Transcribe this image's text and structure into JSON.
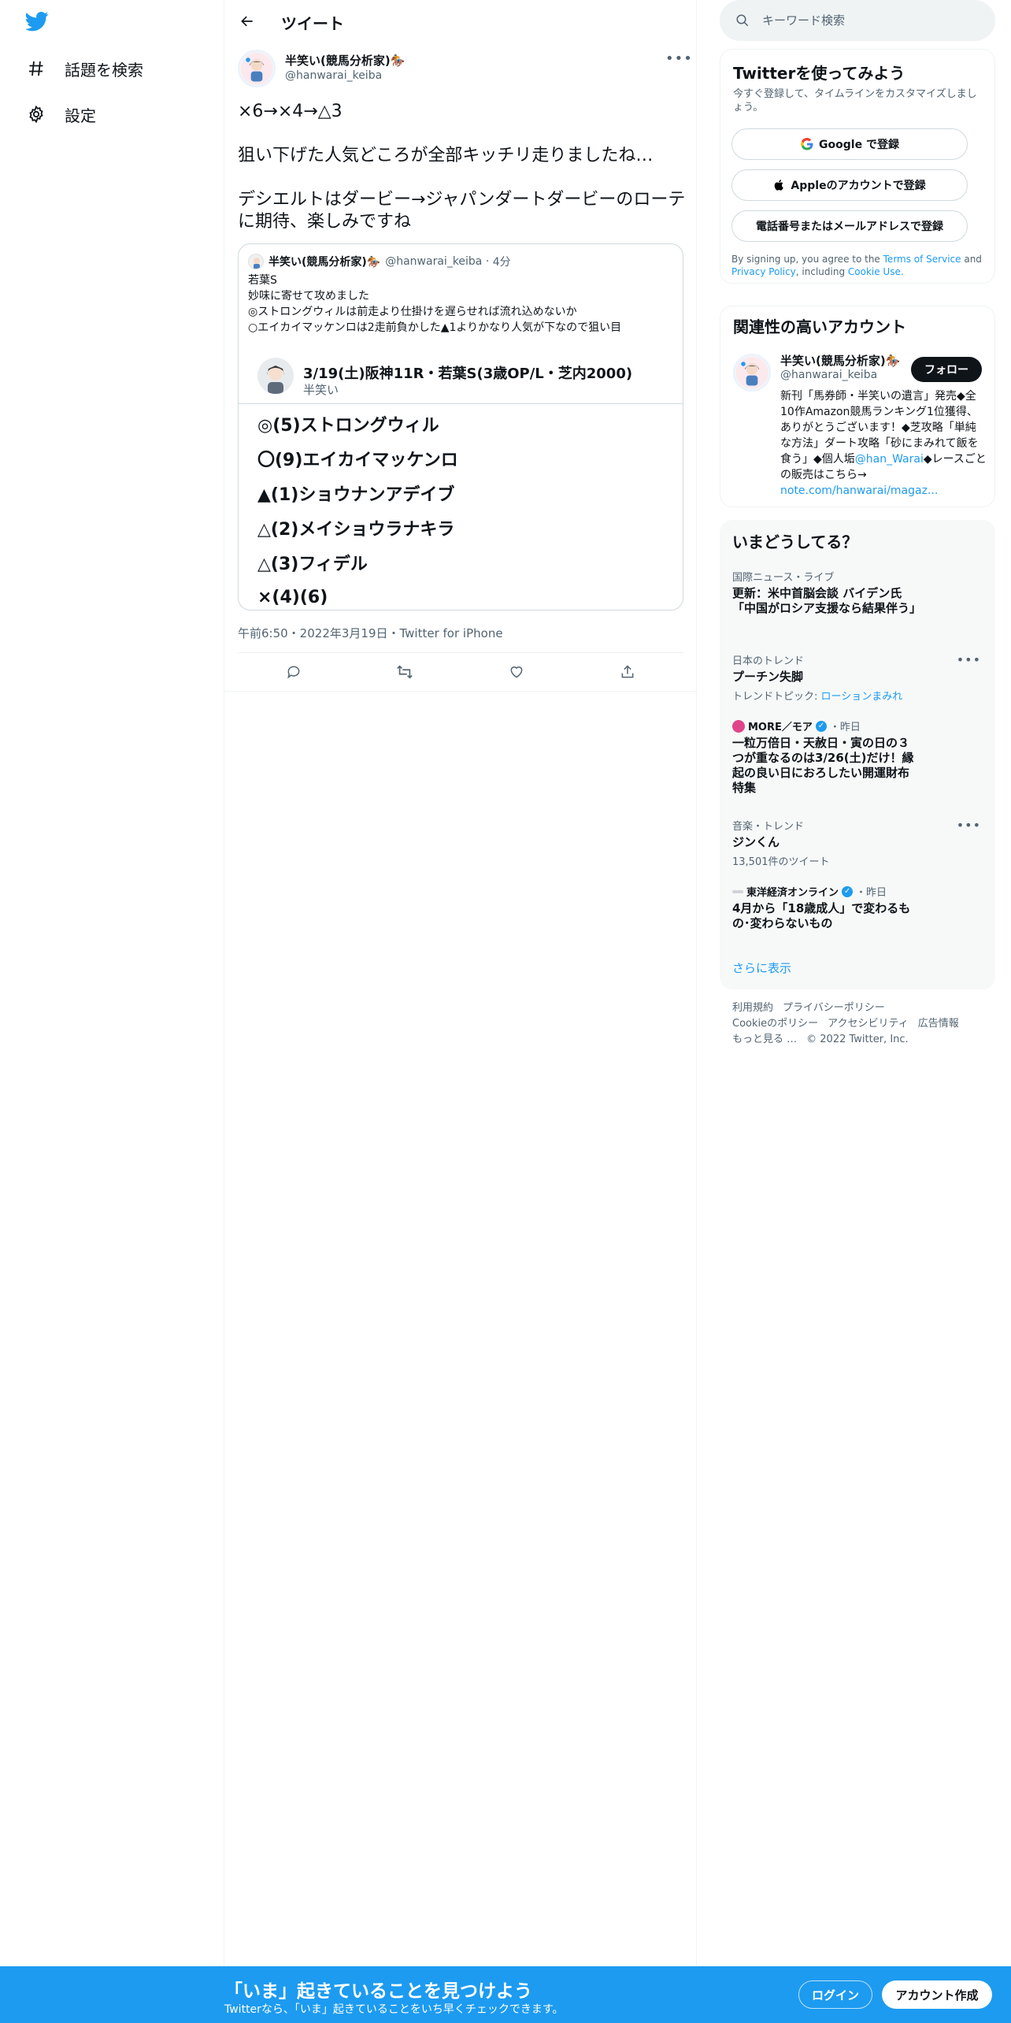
{
  "nav": {
    "items": [
      {
        "label": "話題を検索",
        "icon": "hashtag-icon"
      },
      {
        "label": "設定",
        "icon": "gear-icon"
      }
    ]
  },
  "header": {
    "title": "ツイート"
  },
  "tweet": {
    "author_name": "半笑い(競馬分析家)🏇",
    "author_handle": "@hanwarai_keiba",
    "body": [
      "×6→×4→△3",
      "狙い下げた人気どころが全部キッチリ走りましたね…",
      "デシエルトはダービー→ジャパンダートダービーのローテに期待、楽しみですね"
    ],
    "meta": "午前6:50・2022年3月19日・Twitter for iPhone",
    "quote": {
      "author_name": "半笑い(競馬分析家)🏇",
      "author_handle": "@hanwarai_keiba",
      "time": "4分",
      "text": [
        "若葉S",
        "妙味に寄せて攻めました",
        "◎ストロングウィルは前走より仕掛けを遅らせれば流れ込めないか",
        "○エイカイマッケンロは2走前負かした▲1よりかなり人気が下なので狙い目"
      ],
      "card_title": "3/19(土)阪神11R・若葉S(3歳OP/L・芝内2000)",
      "card_sub": "半笑い",
      "picks": [
        "◎(5)ストロングウィル",
        "〇(9)エイカイマッケンロ",
        "▲(1)ショウナンアデイブ",
        "△(2)メイショウラナキラ",
        "△(3)フィデル",
        "×(4)(6)"
      ]
    }
  },
  "search": {
    "placeholder": "キーワード検索"
  },
  "signup": {
    "title": "Twitterを使ってみよう",
    "subtitle": "今すぐ登録して、タイムラインをカスタマイズしましょう。",
    "google": "Google で登録",
    "apple": "Appleのアカウントで登録",
    "phone": "電話番号またはメールアドレスで登録",
    "terms_prefix": "By signing up, you agree to the ",
    "terms_tos": "Terms of Service",
    "terms_and": " and ",
    "terms_privacy": "Privacy Policy",
    "terms_including": ", including ",
    "terms_cookie": "Cookie Use."
  },
  "related": {
    "title": "関連性の高いアカウント",
    "name": "半笑い(競馬分析家)🏇",
    "handle": "@hanwarai_keiba",
    "follow": "フォロー",
    "bio": "新刊「馬券師・半笑いの遺言」発売◆全10作Amazon競馬ランキング1位獲得、ありがとうございます！◆芝攻略「単純な方法」ダート攻略「砂にまみれて飯を食う」◆個人垢",
    "bio_mention": "@han_Warai",
    "bio_tail": "◆レースごとの販売はこちら→",
    "bio_link": "note.com/hanwarai/magaz..."
  },
  "trends": {
    "title": "いまどうしてる？",
    "items": [
      {
        "meta": "国際ニュース・ライブ",
        "title": "更新：米中首脳会談 バイデン氏「中国がロシア支援なら結果伴う」"
      },
      {
        "meta": "日本のトレンド",
        "title": "プーチン失脚",
        "extra_prefix": "トレンドトピック: ",
        "extra_link": "ローションまみれ"
      },
      {
        "source": "MORE／モア",
        "time": "・昨日",
        "title": "一粒万倍日・天赦日・寅の日の３つが重なるのは3/26(土)だけ！縁起の良い日におろしたい開運財布特集"
      },
      {
        "meta": "音楽・トレンド",
        "title": "ジンくん",
        "extra": "13,501件のツイート"
      },
      {
        "source": "東洋経済オンライン",
        "time": "・昨日",
        "title": "4月から「18歳成人」で変わるもの･変わらないもの"
      }
    ],
    "show_more": "さらに表示"
  },
  "footer": {
    "links": [
      "利用規約",
      "プライバシーポリシー",
      "Cookieのポリシー",
      "アクセシビリティ",
      "広告情報",
      "もっと見る …",
      "© 2022 Twitter, Inc."
    ]
  },
  "bottom_bar": {
    "title": "「いま」起きていることを見つけよう",
    "subtitle": "Twitterなら、「いま」起きていることをいち早くチェックできます。",
    "login": "ログイン",
    "signup": "アカウント作成"
  },
  "colors": {
    "accent": "#1d9bf0",
    "text": "#0f1419",
    "muted": "#536471"
  }
}
